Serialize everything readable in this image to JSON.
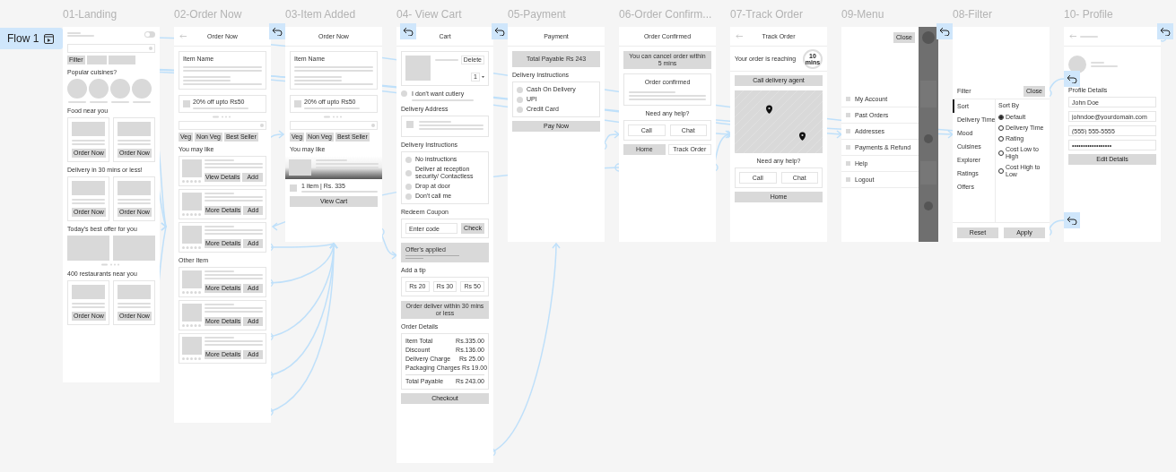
{
  "flow": {
    "label": "Flow 1"
  },
  "frames": [
    {
      "title": "01-Landing",
      "blocks": [
        {
          "kind": "landing-top",
          "on": false
        },
        {
          "kind": "search"
        },
        {
          "kind": "chips",
          "items": [
            "Filter"
          ]
        },
        {
          "kind": "label",
          "text": "Popular cuisines?"
        },
        {
          "kind": "circles"
        },
        {
          "kind": "label",
          "text": "Food near you"
        },
        {
          "kind": "card-pair",
          "buttons": [
            "Order Now",
            "Order Now"
          ]
        },
        {
          "kind": "label",
          "text": "Delivery in 30 mins or less!"
        },
        {
          "kind": "card-pair",
          "buttons": [
            "Order Now",
            "Order Now"
          ]
        },
        {
          "kind": "label",
          "text": "Today's best offer for you"
        },
        {
          "kind": "banner-pair"
        },
        {
          "kind": "label",
          "text": "400 restaurants near you"
        },
        {
          "kind": "card-pair",
          "buttons": [
            "Order Now",
            "Order Now"
          ]
        }
      ]
    },
    {
      "title": "02-Order Now",
      "blocks": [
        {
          "kind": "topbar",
          "text": "Order Now",
          "back": true
        },
        {
          "kind": "item-name-card",
          "text": "Item Name"
        },
        {
          "kind": "offer",
          "text": "20% off upto Rs50"
        },
        {
          "kind": "search"
        },
        {
          "kind": "chips",
          "items": [
            "Veg",
            "Non Veg",
            "Best Seller"
          ]
        },
        {
          "kind": "label",
          "text": "You may like"
        },
        {
          "kind": "item-card",
          "buttons": [
            "View Details",
            "Add"
          ]
        },
        {
          "kind": "item-card",
          "buttons": [
            "More Details",
            "Add"
          ]
        },
        {
          "kind": "item-card",
          "buttons": [
            "More Details",
            "Add"
          ]
        },
        {
          "kind": "label",
          "text": "Other Item"
        },
        {
          "kind": "item-card",
          "buttons": [
            "More Details",
            "Add"
          ]
        },
        {
          "kind": "item-card",
          "buttons": [
            "More Details",
            "Add"
          ]
        },
        {
          "kind": "item-card",
          "buttons": [
            "More Details",
            "Add"
          ]
        }
      ]
    },
    {
      "title": "03-Item Added",
      "blocks": [
        {
          "kind": "topbar",
          "text": "Order Now",
          "back": false
        },
        {
          "kind": "item-name-card",
          "text": "Item Name"
        },
        {
          "kind": "offer",
          "text": "20% off upto Rs50"
        },
        {
          "kind": "search"
        },
        {
          "kind": "chips",
          "items": [
            "Veg",
            "Non Veg",
            "Best Seller"
          ]
        },
        {
          "kind": "label",
          "text": "You may like"
        },
        {
          "kind": "blurred-card"
        },
        {
          "kind": "cart-row",
          "text": "1 item | Rs. 335"
        },
        {
          "kind": "bar-button",
          "text": "View Cart"
        }
      ]
    },
    {
      "title": "04- View Cart",
      "blocks": [
        {
          "kind": "topbar",
          "text": "Cart",
          "back": false
        },
        {
          "kind": "cart-item",
          "action": "Delete",
          "qty": "1"
        },
        {
          "kind": "check-row",
          "text": "I don't want cutlery",
          "checked": false
        },
        {
          "kind": "label",
          "text": "Delivery Address"
        },
        {
          "kind": "address-card"
        },
        {
          "kind": "label",
          "text": "Delivery Instructions"
        },
        {
          "kind": "radio-list",
          "items": [
            {
              "label": "No instructions",
              "selected": false
            },
            {
              "label": "Deliver at reception security/ Contactless",
              "selected": false
            },
            {
              "label": "Drop at door",
              "selected": false
            },
            {
              "label": "Don't call me",
              "selected": false
            }
          ]
        },
        {
          "kind": "label",
          "text": "Redeem Coupon"
        },
        {
          "kind": "coupon",
          "placeholder": "Enter code",
          "button": "Check"
        },
        {
          "kind": "offer-panel",
          "text": "Offer's applied"
        },
        {
          "kind": "label",
          "text": "Add a tip"
        },
        {
          "kind": "tip-row",
          "items": [
            "Rs 20",
            "Rs 30",
            "Rs 50"
          ]
        },
        {
          "kind": "info-box",
          "text": "Order deliver within 30 mins or less"
        },
        {
          "kind": "label",
          "text": "Order Details"
        },
        {
          "kind": "price-rows",
          "rows": [
            {
              "label": "Item Total",
              "value": "Rs.335.00"
            },
            {
              "label": "Discount",
              "value": "Rs.136.00"
            },
            {
              "label": "Delivery Charge",
              "value": "Rs 25.00"
            },
            {
              "label": "Packaging Charges",
              "value": "Rs 19.00"
            },
            {
              "label": "Total Payable",
              "value": "Rs 243.00"
            }
          ]
        },
        {
          "kind": "bar-button",
          "text": "Checkout"
        }
      ]
    },
    {
      "title": "05-Payment",
      "blocks": [
        {
          "kind": "topbar",
          "text": "Payment",
          "back": false
        },
        {
          "kind": "info-box",
          "text": "Total Payable Rs 243"
        },
        {
          "kind": "label",
          "text": "Delivery Instructions"
        },
        {
          "kind": "radio-list",
          "items": [
            {
              "label": "Cash On Delivery",
              "selected": false
            },
            {
              "label": "UPI",
              "selected": false
            },
            {
              "label": "Credit Card",
              "selected": false
            }
          ]
        },
        {
          "kind": "bar-button",
          "text": "Pay Now"
        }
      ]
    },
    {
      "title": "06-Order Confirm...",
      "blocks": [
        {
          "kind": "topbar",
          "text": "Order Confirmed",
          "back": false
        },
        {
          "kind": "info-box",
          "text": "You can cancel order within 5 mins"
        },
        {
          "kind": "confirm-card",
          "text": "Order confirmed"
        },
        {
          "kind": "center-label",
          "text": "Need any help?"
        },
        {
          "kind": "help-buttons",
          "items": [
            "Call",
            "Chat"
          ]
        },
        {
          "kind": "button-pair",
          "items": [
            "Home",
            "Track Order"
          ]
        }
      ]
    },
    {
      "title": "07-Track Order",
      "blocks": [
        {
          "kind": "topbar",
          "text": "Track Order",
          "back": true
        },
        {
          "kind": "eta",
          "text": "Your order is reaching",
          "badge": "10 mins"
        },
        {
          "kind": "bar-button",
          "text": "Call delivery agent"
        },
        {
          "kind": "map"
        },
        {
          "kind": "center-label",
          "text": "Need any help?"
        },
        {
          "kind": "help-buttons",
          "items": [
            "Call",
            "Chat"
          ]
        },
        {
          "kind": "bar-button",
          "text": "Home"
        }
      ]
    },
    {
      "title": "09-Menu",
      "blocks": [
        {
          "kind": "menu-close",
          "text": "Close"
        },
        {
          "kind": "menu-list",
          "items": [
            "My Account",
            "Past Orders",
            "Addresses",
            "Payments & Refund",
            "Help",
            "Logout"
          ]
        }
      ]
    },
    {
      "title": "08-Filter",
      "blocks": [
        {
          "kind": "filter-panel",
          "heading": "Filter",
          "close": "Close",
          "sort_heading": "Sort By",
          "tabs": [
            {
              "label": "Sort",
              "selected": true
            },
            {
              "label": "Delivery Time",
              "selected": false
            },
            {
              "label": "Mood",
              "selected": false
            },
            {
              "label": "Cuisines",
              "selected": false
            },
            {
              "label": "Explorer",
              "selected": false
            },
            {
              "label": "Ratings",
              "selected": false
            },
            {
              "label": "Offers",
              "selected": false
            }
          ],
          "options": [
            {
              "label": "Default",
              "selected": true
            },
            {
              "label": "Delivery Time",
              "selected": false
            },
            {
              "label": "Rating",
              "selected": false
            },
            {
              "label": "Cost Low to High",
              "selected": false
            },
            {
              "label": "Cost High to Low",
              "selected": false
            }
          ],
          "buttons": [
            "Reset",
            "Apply"
          ]
        }
      ]
    },
    {
      "title": "10- Profile",
      "blocks": [
        {
          "kind": "topbar",
          "back": true
        },
        {
          "kind": "avatar"
        },
        {
          "kind": "label",
          "text": "Profile Details"
        },
        {
          "kind": "fields",
          "items": [
            "John Doe",
            "johndoe@yourdomain.com",
            "(555) 555-5555",
            "••••••••••••••••••"
          ]
        },
        {
          "kind": "bar-button",
          "text": "Edit Details"
        }
      ]
    }
  ]
}
